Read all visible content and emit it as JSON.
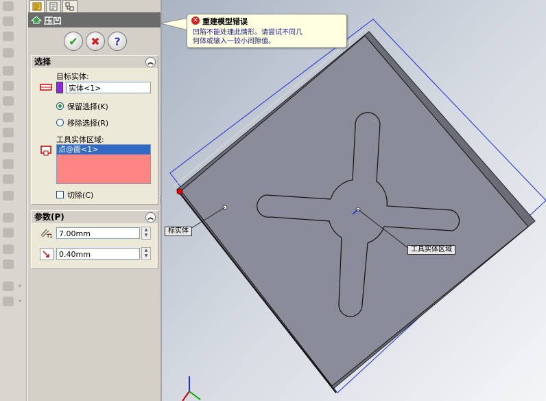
{
  "panel": {
    "title": "压凹",
    "buttons": {
      "ok": "✔",
      "cancel": "✖",
      "help": "?"
    },
    "selection": {
      "header": "选择",
      "target_label": "目标实体:",
      "target_value": "实体<1>",
      "keep_label": "保留选择(K)",
      "remove_label": "移除选择(R)",
      "tool_region_label": "工具实体区域:",
      "tool_region_item": "点@面<1>",
      "cut_label": "切除(C)"
    },
    "params": {
      "header": "参数(P)",
      "thickness": "7.00mm",
      "clearance": "0.40mm"
    }
  },
  "tooltip": {
    "title": "重建模型错误",
    "line1": "凹陷不能处理此情形。请尝试不同几",
    "line2": "何体或输入一较小间隙值。"
  },
  "viewport": {
    "label_target": "标实体",
    "label_tool": "工具实体区域"
  },
  "colors": {
    "tool_region_bg": "#ff8484",
    "selected_item": "#316ac5",
    "target_swatch": "#8a2be2"
  }
}
